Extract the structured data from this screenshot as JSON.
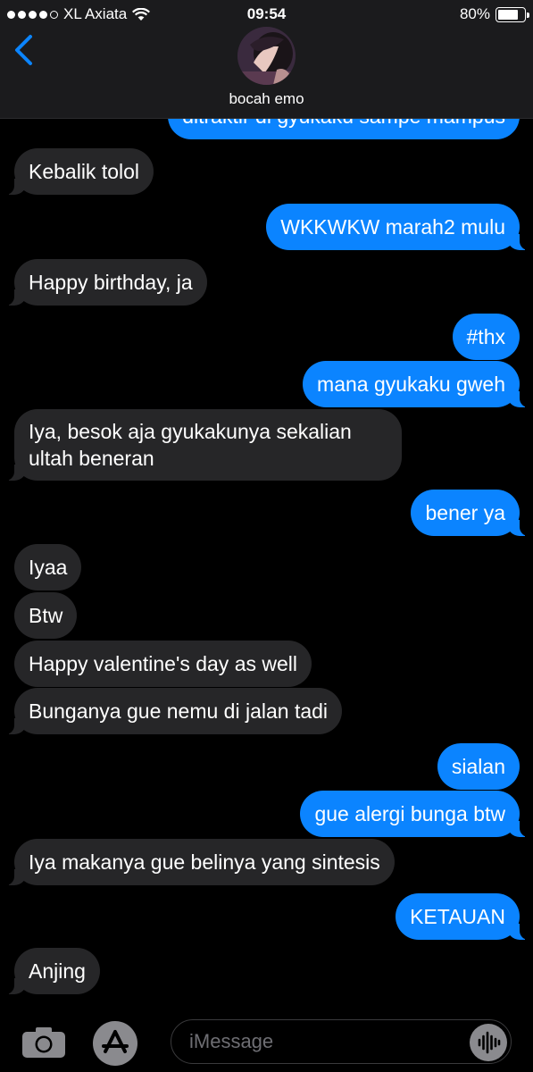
{
  "status_bar": {
    "carrier": "XL Axiata",
    "time": "09:54",
    "battery_percent": "80%",
    "battery_level": 0.8,
    "signal_dots_filled": 4,
    "signal_dots_total": 5
  },
  "header": {
    "contact_name": "bocah emo",
    "back_icon": "chevron-left-icon"
  },
  "messages": [
    {
      "direction": "out",
      "text": "ditraktir di gyukaku sampe mampus"
    },
    {
      "direction": "in",
      "text": "Kebalik tolol"
    },
    {
      "direction": "out",
      "text": "WKKWKW marah2 mulu"
    },
    {
      "direction": "in",
      "text": "Happy birthday, ja"
    },
    {
      "direction": "out",
      "text": "#thx"
    },
    {
      "direction": "out",
      "text": "mana gyukaku gweh"
    },
    {
      "direction": "in",
      "line1": "Iya, besok aja gyukakunya sekalian",
      "line2": "ultah beneran"
    },
    {
      "direction": "out",
      "text": "bener ya"
    },
    {
      "direction": "in",
      "text": "Iyaa"
    },
    {
      "direction": "in",
      "text": "Btw"
    },
    {
      "direction": "in",
      "text": "Happy valentine's day as well"
    },
    {
      "direction": "in",
      "text": "Bunganya gue nemu di jalan tadi"
    },
    {
      "direction": "out",
      "text": "sialan"
    },
    {
      "direction": "out",
      "text": "gue alergi bunga btw"
    },
    {
      "direction": "in",
      "text": "Iya makanya gue belinya yang sintesis"
    },
    {
      "direction": "out",
      "text": "KETAUAN"
    },
    {
      "direction": "in",
      "text": "Anjing"
    }
  ],
  "input_bar": {
    "placeholder": "iMessage",
    "icons": [
      "camera-icon",
      "app-store-icon",
      "audio-waveform-icon"
    ]
  },
  "colors": {
    "outgoing_bubble": "#0b84ff",
    "incoming_bubble": "#262628",
    "header_bg": "#1b1b1d",
    "background": "#000000"
  }
}
